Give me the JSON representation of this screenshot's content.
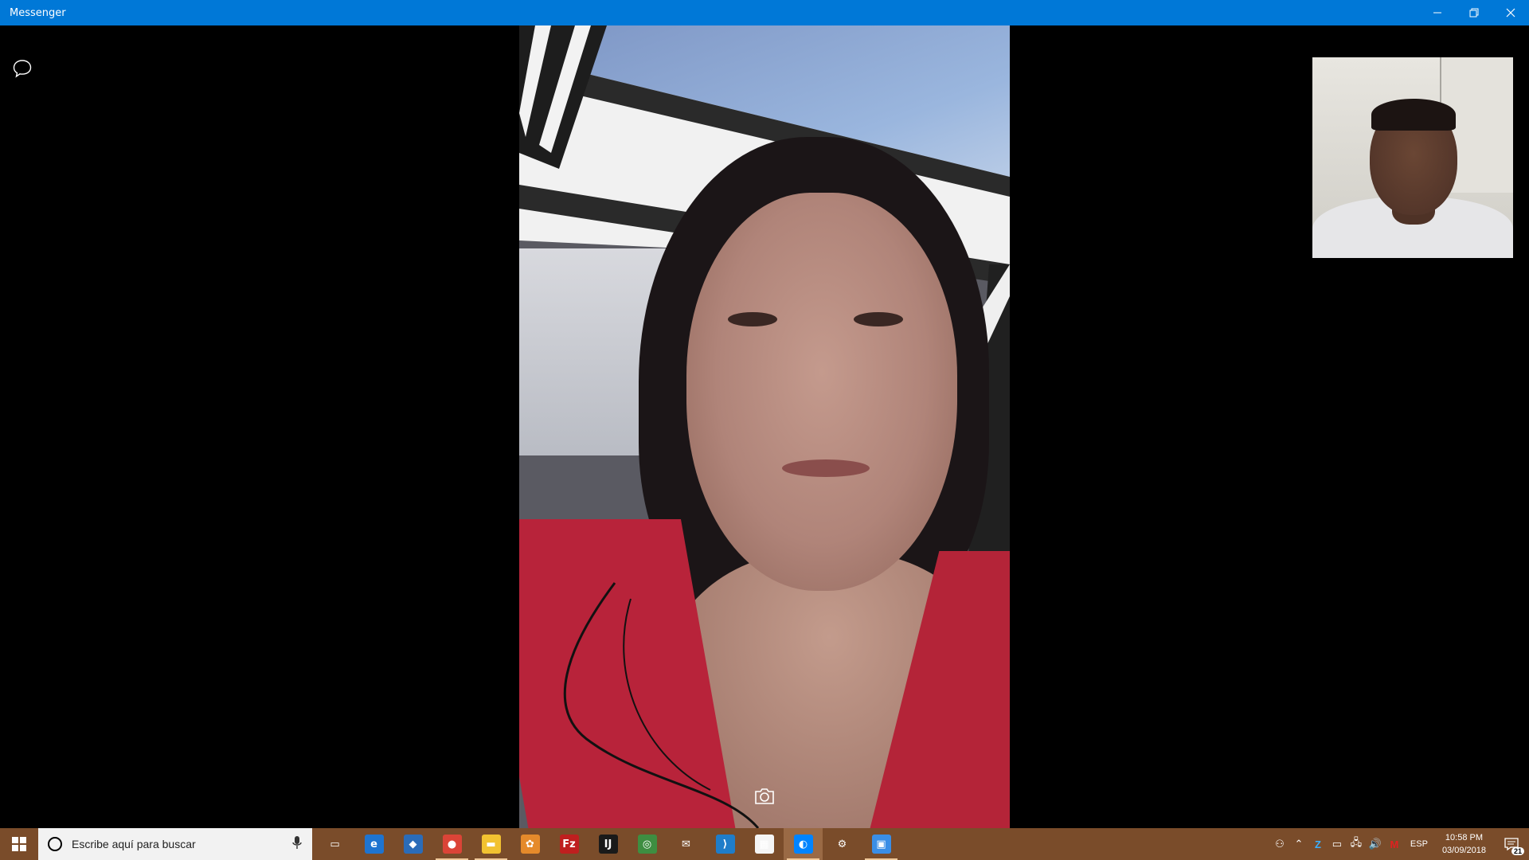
{
  "window": {
    "title": "Messenger",
    "accent_color": "#0078d7",
    "controls": [
      "minimize-icon",
      "restore-icon",
      "close-icon"
    ]
  },
  "call": {
    "chat_toggle_icon": "chat-bubble-icon",
    "snapshot_icon": "camera-icon"
  },
  "taskbar": {
    "color": "#7a4c2a",
    "search_placeholder": "Escribe aquí para buscar",
    "apps": [
      {
        "name": "task-view",
        "glyph": "▭",
        "color": "transparent"
      },
      {
        "name": "edge",
        "glyph": "e",
        "color": "#1e74d0"
      },
      {
        "name": "virtualbox",
        "glyph": "◆",
        "color": "#2b6cb8"
      },
      {
        "name": "chrome",
        "glyph": "●",
        "color": "#db4437"
      },
      {
        "name": "file-explorer",
        "glyph": "▬",
        "color": "#f2c231"
      },
      {
        "name": "paint",
        "glyph": "✿",
        "color": "#e58a2b"
      },
      {
        "name": "filezilla",
        "glyph": "Fz",
        "color": "#bf1f1f"
      },
      {
        "name": "intellij",
        "glyph": "IJ",
        "color": "#1a1a1a"
      },
      {
        "name": "android-studio",
        "glyph": "◎",
        "color": "#3e8e41"
      },
      {
        "name": "mail",
        "glyph": "✉",
        "color": "transparent"
      },
      {
        "name": "vscode",
        "glyph": "⟩",
        "color": "#1f7dc9"
      },
      {
        "name": "store",
        "glyph": "▦",
        "color": "#f5f5f5"
      },
      {
        "name": "messenger",
        "glyph": "◐",
        "color": "#0084ff"
      },
      {
        "name": "settings",
        "glyph": "⚙",
        "color": "transparent"
      },
      {
        "name": "remote-desktop",
        "glyph": "▣",
        "color": "#3a8ee6"
      }
    ],
    "tray": {
      "language": "ESP",
      "time": "10:58 PM",
      "date": "03/09/2018",
      "notification_count": "21"
    }
  }
}
